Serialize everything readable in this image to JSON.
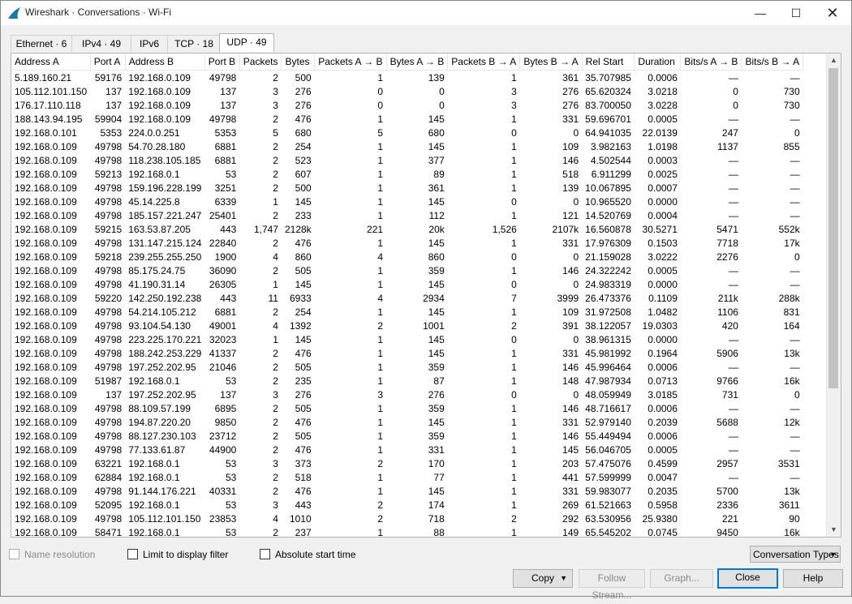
{
  "window": {
    "title": "Wireshark · Conversations · Wi-Fi"
  },
  "tabs": [
    "Ethernet · 6",
    "IPv4 · 49",
    "IPv6",
    "TCP · 18",
    "UDP · 49"
  ],
  "table": {
    "columns": [
      "Address A",
      "Port A",
      "Address B",
      "Port B",
      "Packets",
      "Bytes",
      "Packets A → B",
      "Bytes A → B",
      "Packets B → A",
      "Bytes B → A",
      "Rel Start",
      "Duration",
      "Bits/s A → B",
      "Bits/s B → A"
    ],
    "rows": [
      [
        "5.189.160.21",
        "59176",
        "192.168.0.109",
        "49798",
        "2",
        "500",
        "1",
        "139",
        "1",
        "361",
        "35.707985",
        "0.0006",
        "—",
        "—"
      ],
      [
        "105.112.101.150",
        "137",
        "192.168.0.109",
        "137",
        "3",
        "276",
        "0",
        "0",
        "3",
        "276",
        "65.620324",
        "3.0218",
        "0",
        "730"
      ],
      [
        "176.17.110.118",
        "137",
        "192.168.0.109",
        "137",
        "3",
        "276",
        "0",
        "0",
        "3",
        "276",
        "83.700050",
        "3.0228",
        "0",
        "730"
      ],
      [
        "188.143.94.195",
        "59904",
        "192.168.0.109",
        "49798",
        "2",
        "476",
        "1",
        "145",
        "1",
        "331",
        "59.696701",
        "0.0005",
        "—",
        "—"
      ],
      [
        "192.168.0.101",
        "5353",
        "224.0.0.251",
        "5353",
        "5",
        "680",
        "5",
        "680",
        "0",
        "0",
        "64.941035",
        "22.0139",
        "247",
        "0"
      ],
      [
        "192.168.0.109",
        "49798",
        "54.70.28.180",
        "6881",
        "2",
        "254",
        "1",
        "145",
        "1",
        "109",
        "3.982163",
        "1.0198",
        "1137",
        "855"
      ],
      [
        "192.168.0.109",
        "49798",
        "118.238.105.185",
        "6881",
        "2",
        "523",
        "1",
        "377",
        "1",
        "146",
        "4.502544",
        "0.0003",
        "—",
        "—"
      ],
      [
        "192.168.0.109",
        "59213",
        "192.168.0.1",
        "53",
        "2",
        "607",
        "1",
        "89",
        "1",
        "518",
        "6.911299",
        "0.0025",
        "—",
        "—"
      ],
      [
        "192.168.0.109",
        "49798",
        "159.196.228.199",
        "3251",
        "2",
        "500",
        "1",
        "361",
        "1",
        "139",
        "10.067895",
        "0.0007",
        "—",
        "—"
      ],
      [
        "192.168.0.109",
        "49798",
        "45.14.225.8",
        "6339",
        "1",
        "145",
        "1",
        "145",
        "0",
        "0",
        "10.965520",
        "0.0000",
        "—",
        "—"
      ],
      [
        "192.168.0.109",
        "49798",
        "185.157.221.247",
        "25401",
        "2",
        "233",
        "1",
        "112",
        "1",
        "121",
        "14.520769",
        "0.0004",
        "—",
        "—"
      ],
      [
        "192.168.0.109",
        "59215",
        "163.53.87.205",
        "443",
        "1,747",
        "2128k",
        "221",
        "20k",
        "1,526",
        "2107k",
        "16.560878",
        "30.5271",
        "5471",
        "552k"
      ],
      [
        "192.168.0.109",
        "49798",
        "131.147.215.124",
        "22840",
        "2",
        "476",
        "1",
        "145",
        "1",
        "331",
        "17.976309",
        "0.1503",
        "7718",
        "17k"
      ],
      [
        "192.168.0.109",
        "59218",
        "239.255.255.250",
        "1900",
        "4",
        "860",
        "4",
        "860",
        "0",
        "0",
        "21.159028",
        "3.0222",
        "2276",
        "0"
      ],
      [
        "192.168.0.109",
        "49798",
        "85.175.24.75",
        "36090",
        "2",
        "505",
        "1",
        "359",
        "1",
        "146",
        "24.322242",
        "0.0005",
        "—",
        "—"
      ],
      [
        "192.168.0.109",
        "49798",
        "41.190.31.14",
        "26305",
        "1",
        "145",
        "1",
        "145",
        "0",
        "0",
        "24.983319",
        "0.0000",
        "—",
        "—"
      ],
      [
        "192.168.0.109",
        "59220",
        "142.250.192.238",
        "443",
        "11",
        "6933",
        "4",
        "2934",
        "7",
        "3999",
        "26.473376",
        "0.1109",
        "211k",
        "288k"
      ],
      [
        "192.168.0.109",
        "49798",
        "54.214.105.212",
        "6881",
        "2",
        "254",
        "1",
        "145",
        "1",
        "109",
        "31.972508",
        "1.0482",
        "1106",
        "831"
      ],
      [
        "192.168.0.109",
        "49798",
        "93.104.54.130",
        "49001",
        "4",
        "1392",
        "2",
        "1001",
        "2",
        "391",
        "38.122057",
        "19.0303",
        "420",
        "164"
      ],
      [
        "192.168.0.109",
        "49798",
        "223.225.170.221",
        "32023",
        "1",
        "145",
        "1",
        "145",
        "0",
        "0",
        "38.961315",
        "0.0000",
        "—",
        "—"
      ],
      [
        "192.168.0.109",
        "49798",
        "188.242.253.229",
        "41337",
        "2",
        "476",
        "1",
        "145",
        "1",
        "331",
        "45.981992",
        "0.1964",
        "5906",
        "13k"
      ],
      [
        "192.168.0.109",
        "49798",
        "197.252.202.95",
        "21046",
        "2",
        "505",
        "1",
        "359",
        "1",
        "146",
        "45.996464",
        "0.0006",
        "—",
        "—"
      ],
      [
        "192.168.0.109",
        "51987",
        "192.168.0.1",
        "53",
        "2",
        "235",
        "1",
        "87",
        "1",
        "148",
        "47.987934",
        "0.0713",
        "9766",
        "16k"
      ],
      [
        "192.168.0.109",
        "137",
        "197.252.202.95",
        "137",
        "3",
        "276",
        "3",
        "276",
        "0",
        "0",
        "48.059949",
        "3.0185",
        "731",
        "0"
      ],
      [
        "192.168.0.109",
        "49798",
        "88.109.57.199",
        "6895",
        "2",
        "505",
        "1",
        "359",
        "1",
        "146",
        "48.716617",
        "0.0006",
        "—",
        "—"
      ],
      [
        "192.168.0.109",
        "49798",
        "194.87.220.20",
        "9850",
        "2",
        "476",
        "1",
        "145",
        "1",
        "331",
        "52.979140",
        "0.2039",
        "5688",
        "12k"
      ],
      [
        "192.168.0.109",
        "49798",
        "88.127.230.103",
        "23712",
        "2",
        "505",
        "1",
        "359",
        "1",
        "146",
        "55.449494",
        "0.0006",
        "—",
        "—"
      ],
      [
        "192.168.0.109",
        "49798",
        "77.133.61.87",
        "44900",
        "2",
        "476",
        "1",
        "331",
        "1",
        "145",
        "56.046705",
        "0.0005",
        "—",
        "—"
      ],
      [
        "192.168.0.109",
        "63221",
        "192.168.0.1",
        "53",
        "3",
        "373",
        "2",
        "170",
        "1",
        "203",
        "57.475076",
        "0.4599",
        "2957",
        "3531"
      ],
      [
        "192.168.0.109",
        "62884",
        "192.168.0.1",
        "53",
        "2",
        "518",
        "1",
        "77",
        "1",
        "441",
        "57.599999",
        "0.0047",
        "—",
        "—"
      ],
      [
        "192.168.0.109",
        "49798",
        "91.144.176.221",
        "40331",
        "2",
        "476",
        "1",
        "145",
        "1",
        "331",
        "59.983077",
        "0.2035",
        "5700",
        "13k"
      ],
      [
        "192.168.0.109",
        "52095",
        "192.168.0.1",
        "53",
        "3",
        "443",
        "2",
        "174",
        "1",
        "269",
        "61.521663",
        "0.5958",
        "2336",
        "3611"
      ],
      [
        "192.168.0.109",
        "49798",
        "105.112.101.150",
        "23853",
        "4",
        "1010",
        "2",
        "718",
        "2",
        "292",
        "63.530956",
        "25.9380",
        "221",
        "90"
      ],
      [
        "192.168.0.109",
        "58471",
        "192.168.0.1",
        "53",
        "2",
        "237",
        "1",
        "88",
        "1",
        "149",
        "65.545202",
        "0.0745",
        "9450",
        "16k"
      ]
    ]
  },
  "options": {
    "name_resolution": "Name resolution",
    "limit_filter": "Limit to display filter",
    "absolute_time": "Absolute start time"
  },
  "buttons": {
    "conversation_types": "Conversation Types",
    "copy": "Copy",
    "follow_stream": "Follow Stream...",
    "graph": "Graph...",
    "close": "Close",
    "help": "Help"
  },
  "icons": {
    "app": "wireshark-fin-icon",
    "minimize": "minimize-icon",
    "maximize": "maximize-icon",
    "close": "close-icon"
  },
  "colors": {
    "accent": "#0078d7",
    "app_icon": "#1679a7"
  }
}
